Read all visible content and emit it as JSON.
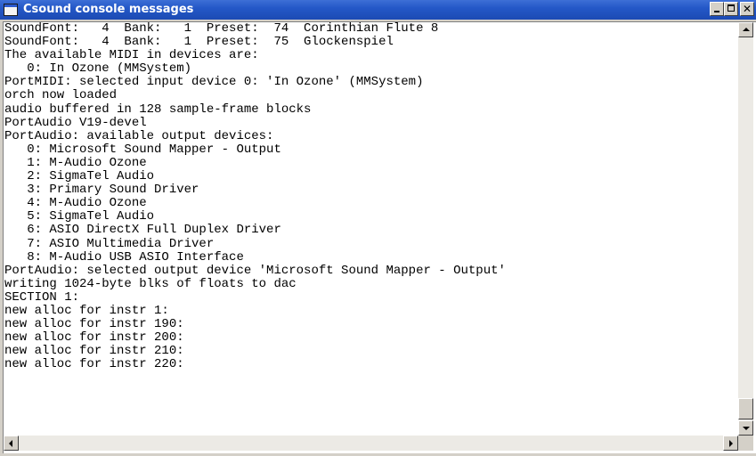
{
  "window": {
    "title": "Csound console messages",
    "icon": "console-window-icon"
  },
  "caption_buttons": [
    "minimize-icon",
    "maximize-icon",
    "close-icon"
  ],
  "console": {
    "lines": [
      "SoundFont:   4  Bank:   1  Preset:  74  Corinthian Flute 8",
      "SoundFont:   4  Bank:   1  Preset:  75  Glockenspiel",
      "The available MIDI in devices are:",
      "   0: In Ozone (MMSystem)",
      "PortMIDI: selected input device 0: 'In Ozone' (MMSystem)",
      "orch now loaded",
      "audio buffered in 128 sample-frame blocks",
      "PortAudio V19-devel",
      "PortAudio: available output devices:",
      "   0: Microsoft Sound Mapper - Output",
      "   1: M-Audio Ozone",
      "   2: SigmaTel Audio",
      "   3: Primary Sound Driver",
      "   4: M-Audio Ozone",
      "   5: SigmaTel Audio",
      "   6: ASIO DirectX Full Duplex Driver",
      "   7: ASIO Multimedia Driver",
      "   8: M-Audio USB ASIO Interface",
      "PortAudio: selected output device 'Microsoft Sound Mapper - Output'",
      "writing 1024-byte blks of floats to dac",
      "SECTION 1:",
      "new alloc for instr 1:",
      "new alloc for instr 190:",
      "new alloc for instr 200:",
      "new alloc for instr 210:",
      "new alloc for instr 220:"
    ]
  }
}
